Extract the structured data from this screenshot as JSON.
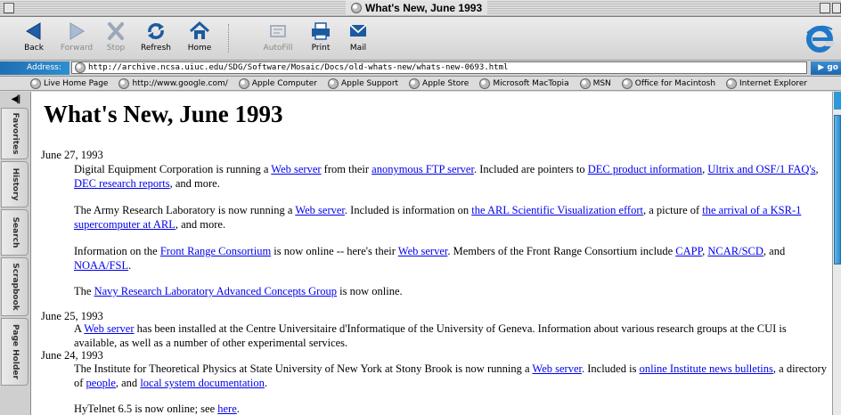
{
  "window": {
    "title": "What's New, June 1993"
  },
  "toolbar": {
    "buttons": [
      {
        "label": "Back",
        "icon": "back-arrow-icon",
        "enabled": true
      },
      {
        "label": "Forward",
        "icon": "forward-arrow-icon",
        "enabled": false
      },
      {
        "label": "Stop",
        "icon": "stop-icon",
        "enabled": false
      },
      {
        "label": "Refresh",
        "icon": "refresh-icon",
        "enabled": true
      },
      {
        "label": "Home",
        "icon": "home-icon",
        "enabled": true
      },
      {
        "label": "AutoFill",
        "icon": "autofill-icon",
        "enabled": false
      },
      {
        "label": "Print",
        "icon": "print-icon",
        "enabled": true
      },
      {
        "label": "Mail",
        "icon": "mail-icon",
        "enabled": true
      }
    ]
  },
  "address": {
    "label": "Address:",
    "url": "http://archive.ncsa.uiuc.edu/SDG/Software/Mosaic/Docs/old-whats-new/whats-new-0693.html",
    "go_label": "go"
  },
  "favorites": [
    "Live Home Page",
    "http://www.google.com/",
    "Apple Computer",
    "Apple Support",
    "Apple Store",
    "Microsoft MacTopia",
    "MSN",
    "Office for Macintosh",
    "Internet Explorer"
  ],
  "sidebar": {
    "tabs": [
      "Favorites",
      "History",
      "Search",
      "Scrapbook",
      "Page Holder"
    ]
  },
  "page": {
    "heading": "What's New, June 1993",
    "dates": [
      "June 27, 1993",
      "June 25, 1993",
      "June 24, 1993"
    ],
    "p1": {
      "t1": "Digital Equipment Corporation is running a ",
      "l1": "Web server",
      "t2": " from their ",
      "l2": "anonymous FTP server",
      "t3": ". Included are pointers to ",
      "l3": "DEC product information",
      "t4": ", ",
      "l4": "Ultrix and OSF/1 FAQ's",
      "t5": ", ",
      "l5": "DEC research reports",
      "t6": ", and more."
    },
    "p2": {
      "t1": "The Army Research Laboratory is now running a ",
      "l1": "Web server",
      "t2": ". Included is information on ",
      "l2": "the ARL Scientific Visualization effort",
      "t3": ", a picture of ",
      "l3": "the arrival of a KSR-1 supercomputer at ARL",
      "t4": ", and more."
    },
    "p3": {
      "t1": "Information on the ",
      "l1": "Front Range Consortium",
      "t2": " is now online -- here's their ",
      "l2": "Web server",
      "t3": ". Members of the Front Range Consortium include ",
      "l3": "CAPP",
      "t4": ", ",
      "l4": "NCAR/SCD",
      "t5": ", and ",
      "l5": "NOAA/FSL",
      "t6": "."
    },
    "p4": {
      "t1": "The ",
      "l1": "Navy Research Laboratory Advanced Concepts Group",
      "t2": " is now online."
    },
    "p5": {
      "t1": "A ",
      "l1": "Web server",
      "t2": " has been installed at the Centre Universitaire d'Informatique of the University of Geneva. Information about various research groups at the CUI is available, as well as a number of other experimental services."
    },
    "p6": {
      "t1": "The Institute for Theoretical Physics at State University of New York at Stony Brook is now running a ",
      "l1": "Web server",
      "t2": ". Included is ",
      "l2": "online Institute news bulletins",
      "t3": ", a directory of ",
      "l3": "people",
      "t4": ", and ",
      "l4": "local system documentation",
      "t5": "."
    },
    "p7": {
      "t1": "HyTelnet 6.5 is now online; see ",
      "l1": "here",
      "t2": "."
    }
  },
  "colors": {
    "link": "#0000ee",
    "address_blue": "#1f6fb3",
    "scroll_blue": "#2b9ad8"
  }
}
